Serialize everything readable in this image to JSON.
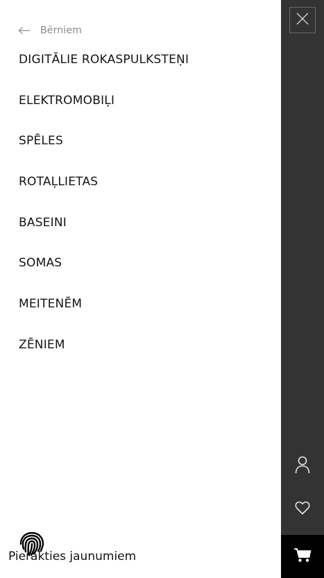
{
  "back": {
    "label": "Bērniem",
    "icon": "arrow-left-icon"
  },
  "menu": {
    "items": [
      {
        "label": "DIGITĀLIE ROKASPULKSTEŅI"
      },
      {
        "label": "ELEKTROMOBIĻI"
      },
      {
        "label": "SPĒLES"
      },
      {
        "label": "ROTAĻLIETAS"
      },
      {
        "label": "BASEINI"
      },
      {
        "label": "SOMAS"
      },
      {
        "label": "MEITENĒM"
      },
      {
        "label": "ZĒNIEM"
      }
    ]
  },
  "footer": {
    "subscribe_text": "Pierakties jaunumiem"
  },
  "rail": {
    "close_icon": "close-icon",
    "account_icon": "user-icon",
    "wishlist_icon": "heart-icon",
    "cart_icon": "cart-icon"
  },
  "colors": {
    "rail_background": "#333333",
    "cart_background": "#000000",
    "back_label": "#8a8a8a"
  }
}
